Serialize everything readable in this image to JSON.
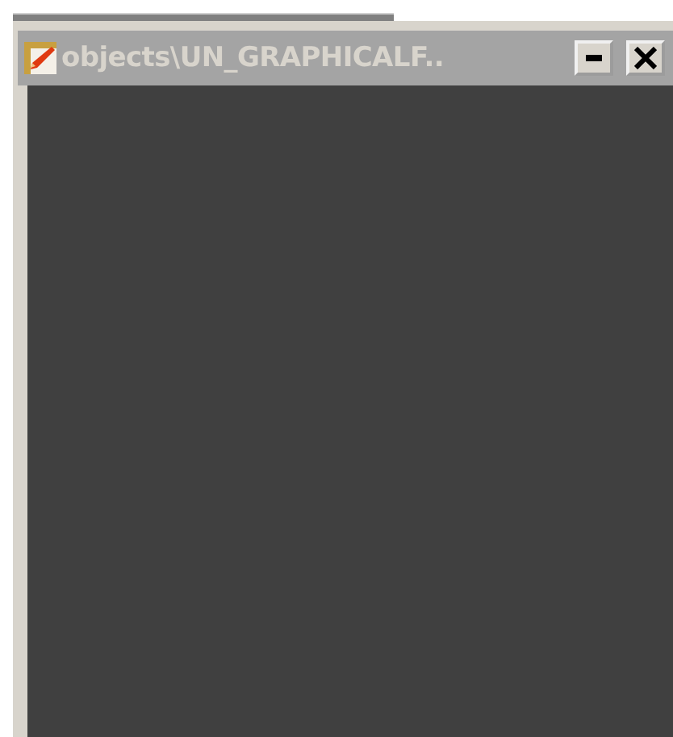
{
  "window": {
    "title": "objects\\UN_GRAPHICALF..",
    "active": false
  }
}
